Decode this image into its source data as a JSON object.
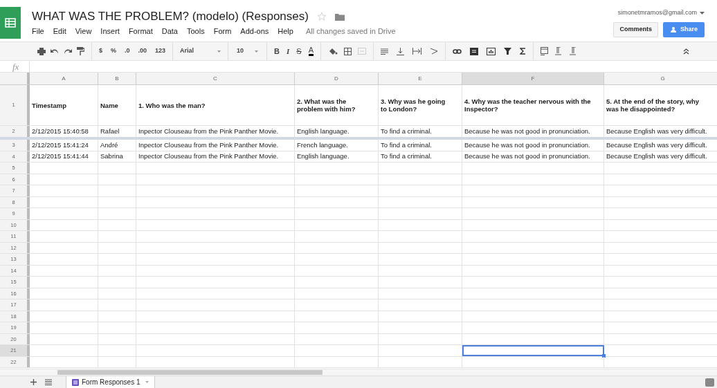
{
  "window": {
    "title": "WHAT WAS THE PROBLEM? (modelo) (Responses)",
    "starred": false
  },
  "menu": [
    "File",
    "Edit",
    "View",
    "Insert",
    "Format",
    "Data",
    "Tools",
    "Form",
    "Add-ons",
    "Help"
  ],
  "save_status": "All changes saved in Drive",
  "account": "simonetmramos@gmail.com",
  "buttons": {
    "comments": "Comments",
    "share": "Share"
  },
  "toolbar": {
    "currency": "$",
    "percent": "%",
    "decrease_decimals": ".0",
    "increase_decimals": ".00",
    "number_format": "123",
    "font": "Arial",
    "font_size": "10",
    "bold": "B",
    "italic": "I",
    "strikethrough": "S",
    "text_color": "A"
  },
  "formula_bar": {
    "label": "fx"
  },
  "columns": [
    {
      "letter": "A",
      "selected": false
    },
    {
      "letter": "B",
      "selected": false
    },
    {
      "letter": "C",
      "selected": false
    },
    {
      "letter": "D",
      "selected": false
    },
    {
      "letter": "E",
      "selected": false
    },
    {
      "letter": "F",
      "selected": true
    },
    {
      "letter": "G",
      "selected": false
    }
  ],
  "rows": [
    {
      "number": "1",
      "kind": "header",
      "divider_below": false,
      "selected": false,
      "cells": [
        "Timestamp",
        "Name",
        "1. Who was the man?",
        "2. What was the problem with him?",
        "3. Why was he going to London?",
        "4. Why was the teacher nervous with the Inspector?",
        "5. At the end of the story, why was he disappointed?"
      ]
    },
    {
      "number": "2",
      "kind": "data",
      "divider_below": true,
      "selected": false,
      "cells": [
        "2/12/2015 15:40:58",
        "Rafael",
        "Inpector Clouseau from the Pink Panther Movie.",
        "English language.",
        "To find a criminal.",
        "Because he was not good in pronunciation.",
        "Because English was very difficult."
      ]
    },
    {
      "number": "3",
      "kind": "data",
      "divider_below": false,
      "selected": false,
      "cells": [
        "2/12/2015 15:41:24",
        "André",
        "Inpector Clouseau from the Pink Panther Movie.",
        "French language.",
        "To find a criminal.",
        "Because he was not good in pronunciation.",
        "Because English was very difficult."
      ]
    },
    {
      "number": "4",
      "kind": "data",
      "divider_below": false,
      "selected": false,
      "cells": [
        "2/12/2015 15:41:44",
        "Sabrina",
        "Inpector Clouseau from the Pink Panther Movie.",
        "English language.",
        "To find a criminal.",
        "Because he was not good in pronunciation.",
        "Because English was very difficult."
      ]
    },
    {
      "number": "5",
      "divider_below": false,
      "selected": false
    },
    {
      "number": "6",
      "divider_below": false,
      "selected": false
    },
    {
      "number": "7",
      "divider_below": false,
      "selected": false
    },
    {
      "number": "8",
      "divider_below": false,
      "selected": false
    },
    {
      "number": "9",
      "divider_below": false,
      "selected": false
    },
    {
      "number": "10",
      "divider_below": false,
      "selected": false
    },
    {
      "number": "11",
      "divider_below": false,
      "selected": false
    },
    {
      "number": "12",
      "divider_below": false,
      "selected": false
    },
    {
      "number": "13",
      "divider_below": false,
      "selected": false
    },
    {
      "number": "14",
      "divider_below": false,
      "selected": false
    },
    {
      "number": "15",
      "divider_below": false,
      "selected": false
    },
    {
      "number": "16",
      "divider_below": false,
      "selected": false
    },
    {
      "number": "17",
      "divider_below": false,
      "selected": false
    },
    {
      "number": "18",
      "divider_below": false,
      "selected": false
    },
    {
      "number": "19",
      "divider_below": false,
      "selected": false
    },
    {
      "number": "20",
      "divider_below": false,
      "selected": false
    },
    {
      "number": "21",
      "divider_below": false,
      "selected": true
    },
    {
      "number": "22",
      "divider_below": false,
      "selected": false
    }
  ],
  "sheet_tabs": [
    {
      "label": "Form Responses 1",
      "selected": true
    }
  ]
}
